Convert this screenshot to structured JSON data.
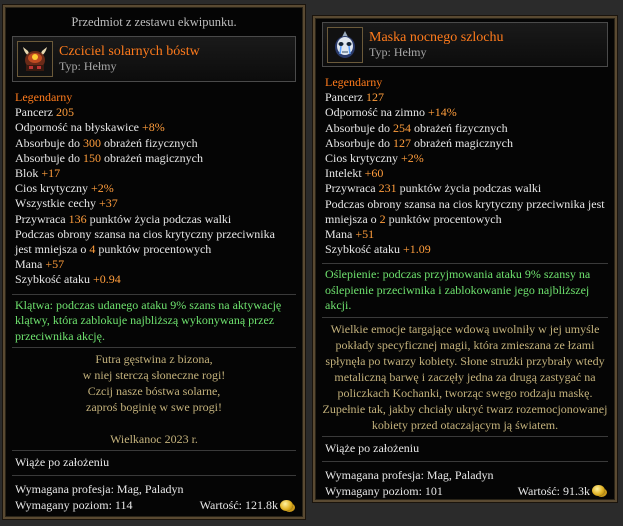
{
  "left": {
    "set_note": "Przedmiot z zestawu ekwipunku.",
    "name": "Czciciel solarnych bóstw",
    "type": "Typ: Hełmy",
    "rarity": "Legendarny",
    "stats": [
      {
        "pre": "Pancerz ",
        "val": "205",
        "post": ""
      },
      {
        "pre": "Odporność na błyskawice ",
        "val": "+8%",
        "post": ""
      },
      {
        "pre": "Absorbuje do ",
        "val": "300",
        "post": " obrażeń fizycznych"
      },
      {
        "pre": "Absorbuje do ",
        "val": "150",
        "post": " obrażeń magicznych"
      },
      {
        "pre": "Blok ",
        "val": "+17",
        "post": ""
      },
      {
        "pre": "Cios krytyczny ",
        "val": "+2%",
        "post": ""
      },
      {
        "pre": "Wszystkie cechy ",
        "val": "+37",
        "post": ""
      },
      {
        "pre": "Przywraca ",
        "val": "136",
        "post": " punktów życia podczas walki"
      },
      {
        "pre": "Podczas obrony szansa na cios krytyczny przeciwnika jest mniejsza o ",
        "val": "4",
        "post": " punktów procentowych"
      },
      {
        "pre": "Mana ",
        "val": "+57",
        "post": ""
      },
      {
        "pre": "Szybkość ataku ",
        "val": "+0.94",
        "post": ""
      }
    ],
    "special": "Klątwa: podczas udanego ataku 9% szans na aktywację klątwy, która zablokuje najbliższą wykonywaną przez przeciwnika akcję.",
    "flavor_lines": [
      "Futra gęstwina z bizona,",
      "w niej sterczą słoneczne rogi!",
      "Czcij nasze bóstwa solarne,",
      "zaproś boginię w swe progi!"
    ],
    "event": "Wielkanoc 2023 r.",
    "binds": "Wiąże po założeniu",
    "profession": "Wymagana profesja: Mag, Paladyn",
    "level": "Wymagany poziom: 114",
    "value": "Wartość: 121.8k"
  },
  "right": {
    "name": "Maska nocnego szlochu",
    "type": "Typ: Hełmy",
    "rarity": "Legendarny",
    "stats": [
      {
        "pre": "Pancerz ",
        "val": "127",
        "post": ""
      },
      {
        "pre": "Odporność na zimno ",
        "val": "+14%",
        "post": ""
      },
      {
        "pre": "Absorbuje do ",
        "val": "254",
        "post": " obrażeń fizycznych"
      },
      {
        "pre": "Absorbuje do ",
        "val": "127",
        "post": " obrażeń magicznych"
      },
      {
        "pre": "Cios krytyczny ",
        "val": "+2%",
        "post": ""
      },
      {
        "pre": "Intelekt ",
        "val": "+60",
        "post": ""
      },
      {
        "pre": "Przywraca ",
        "val": "231",
        "post": " punktów życia podczas walki"
      },
      {
        "pre": "Podczas obrony szansa na cios krytyczny przeciwnika jest mniejsza o ",
        "val": "2",
        "post": " punktów procentowych"
      },
      {
        "pre": "Mana ",
        "val": "+51",
        "post": ""
      },
      {
        "pre": "Szybkość ataku ",
        "val": "+1.09",
        "post": ""
      }
    ],
    "special": "Oślepienie: podczas przyjmowania ataku 9% szansy na oślepienie przeciwnika i zablokowanie jego najbliższej akcji.",
    "flavor": "Wielkie emocje targające wdową uwolniły w jej umyśle pokłady specyficznej magii, która zmieszana ze łzami spłynęła po twarzy kobiety. Słone strużki przybrały wtedy metaliczną barwę i zaczęły jedna za drugą zastygać na policzkach Kochanki, tworząc swego rodzaju maskę. Zupełnie tak, jakby chciały ukryć twarz rozemocjonowanej kobiety przed otaczającym ją światem.",
    "binds": "Wiąże po założeniu",
    "profession": "Wymagana profesja: Mag, Paladyn",
    "level": "Wymagany poziom: 101",
    "value": "Wartość: 91.3k"
  },
  "icons": {
    "left_item": "horned-helmet-icon",
    "right_item": "night-mask-icon",
    "currency": "gold-coin-icon"
  },
  "colors": {
    "legendary": "#ff7b1c",
    "stat_value": "#ff9d3c",
    "special": "#6fe36f",
    "flavor": "#c4b27c",
    "border": "#5a4a32"
  }
}
